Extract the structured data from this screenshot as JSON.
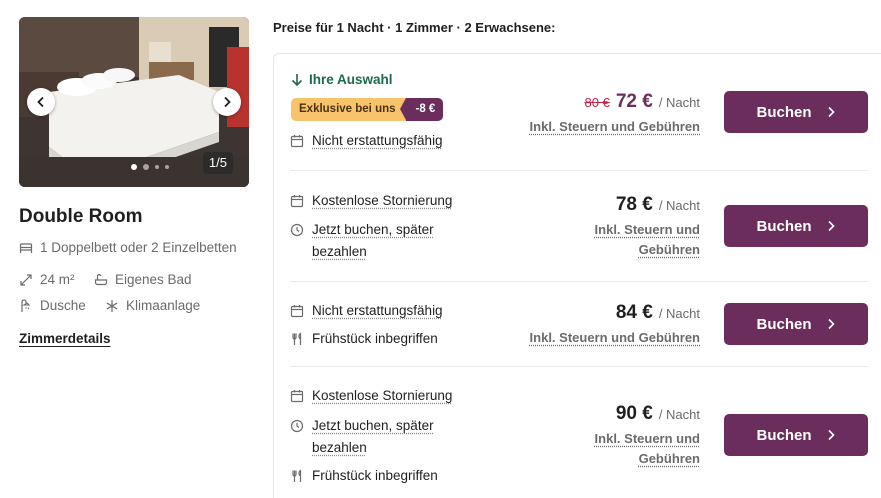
{
  "gallery": {
    "counter": "1/5",
    "prev_icon": "chevron-left-icon",
    "next_icon": "chevron-right-icon"
  },
  "room": {
    "title": "Double Room",
    "features": {
      "beds": "1 Doppelbett oder 2 Einzelbetten",
      "size": "24 m²",
      "bath": "Eigenes Bad",
      "shower": "Dusche",
      "ac": "Klimaanlage"
    },
    "details_link": "Zimmerdetails"
  },
  "prices_header": "Preise für 1 Nacht · 1 Zimmer · 2 Erwachsene:",
  "offers": [
    {
      "selection_label": "Ihre Auswahl",
      "badge_label": "Exklusive bei uns",
      "badge_discount": "-8 €",
      "conditions": [
        "Nicht erstattungsfähig"
      ],
      "old_price": "80 €",
      "price": "72 €",
      "per": "/ Nacht",
      "tax_note": "Inkl. Steuern und Gebühren",
      "button": "Buchen"
    },
    {
      "conditions": [
        "Kostenlose Stornierung",
        "Jetzt buchen, später",
        "bezahlen"
      ],
      "price": "78 €",
      "per": "/ Nacht",
      "tax_line1": "Inkl. Steuern und",
      "tax_line2": "Gebühren",
      "button": "Buchen"
    },
    {
      "conditions": [
        "Nicht erstattungsfähig",
        "Frühstück inbegriffen"
      ],
      "price": "84 €",
      "per": "/ Nacht",
      "tax_note": "Inkl. Steuern und Gebühren",
      "button": "Buchen"
    },
    {
      "conditions": [
        "Kostenlose Stornierung",
        "Jetzt buchen, später",
        "bezahlen",
        "Frühstück inbegriffen"
      ],
      "price": "90 €",
      "per": "/ Nacht",
      "tax_line1": "Inkl. Steuern und",
      "tax_line2": "Gebühren",
      "button": "Buchen"
    }
  ],
  "colors": {
    "brand": "#6b2d5c",
    "selection_green": "#1e6b4a",
    "badge_yellow": "#f7c46b",
    "strike_red": "#c0264b"
  }
}
